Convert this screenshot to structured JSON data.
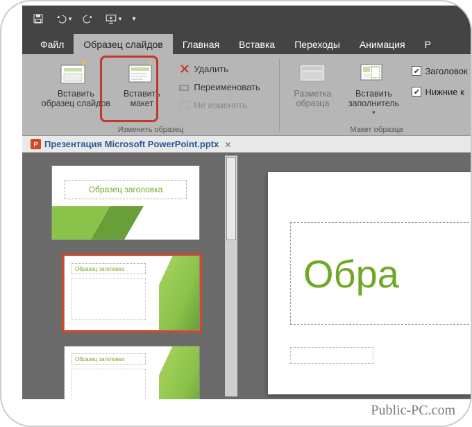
{
  "qat": {
    "save": "save-icon",
    "undo": "undo-icon",
    "redo": "redo-icon",
    "from_beginning": "slideshow-icon",
    "customize": "customize-icon"
  },
  "tabs": {
    "file": "Файл",
    "slide_master": "Образец слайдов",
    "home": "Главная",
    "insert": "Вставка",
    "transitions": "Переходы",
    "animations": "Анимация",
    "review_initial": "Р"
  },
  "ribbon": {
    "edit_master_group": {
      "insert_slide_master": "Вставить образец слайдов",
      "insert_layout": "Вставить макет",
      "delete": "Удалить",
      "rename": "Переименовать",
      "preserve": "Не изменять",
      "label": "Изменить образец"
    },
    "master_layout_group": {
      "master_layout": "Разметка образца",
      "insert_placeholder": "Вставить заполнитель",
      "show_title": "Заголовок",
      "show_footers": "Нижние к",
      "label": "Макет образца"
    }
  },
  "document": {
    "filename": "Презентация Microsoft PowerPoint.pptx"
  },
  "thumbs": {
    "master_title": "Образец заголовка",
    "layout_title": "Образец заголовка"
  },
  "editor": {
    "title_text": "Обра"
  },
  "watermark": "Public-PC.com"
}
